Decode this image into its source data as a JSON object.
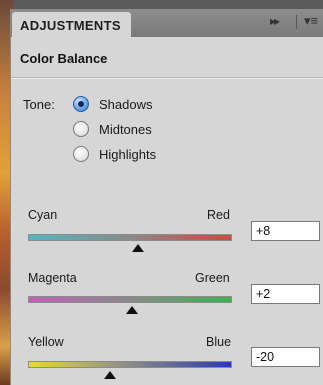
{
  "panel": {
    "tab_label": "ADJUSTMENTS",
    "tab_close": "×",
    "expand_glyph": "▸▸",
    "menu_glyph": "▾≡",
    "title": "Color Balance"
  },
  "tone": {
    "label": "Tone:",
    "options": [
      {
        "label": "Shadows",
        "selected": true
      },
      {
        "label": "Midtones",
        "selected": false
      },
      {
        "label": "Highlights",
        "selected": false
      }
    ]
  },
  "sliders": [
    {
      "left_label": "Cyan",
      "right_label": "Red",
      "value": "+8",
      "range": [
        -100,
        100
      ],
      "left_color": "#4fb8c0",
      "right_color": "#e04040"
    },
    {
      "left_label": "Magenta",
      "right_label": "Green",
      "value": "+2",
      "range": [
        -100,
        100
      ],
      "left_color": "#c060b8",
      "right_color": "#3cb050"
    },
    {
      "left_label": "Yellow",
      "right_label": "Blue",
      "value": "-20",
      "range": [
        -100,
        100
      ],
      "left_color": "#e8d83a",
      "right_color": "#2a3ab0"
    }
  ]
}
